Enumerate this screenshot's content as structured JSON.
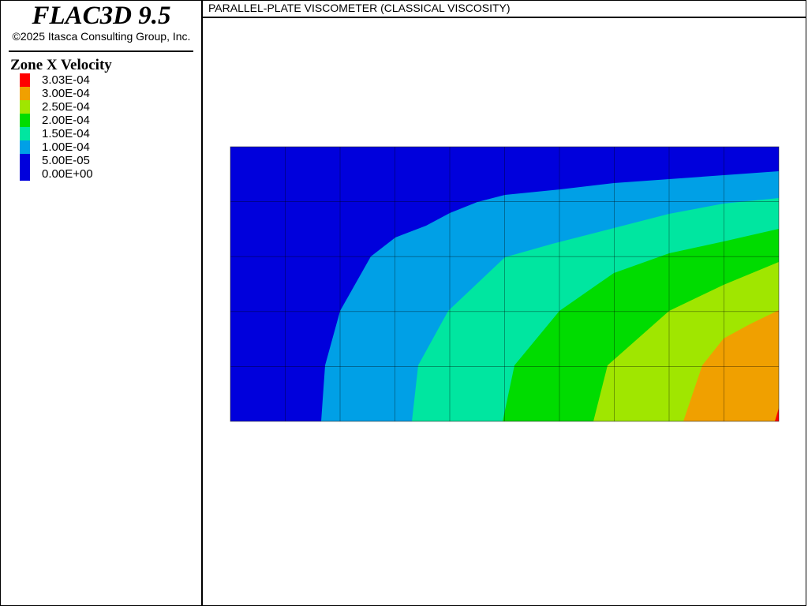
{
  "app": {
    "title": "FLAC3D 9.5",
    "copyright": "©2025 Itasca Consulting Group, Inc."
  },
  "legend": {
    "title": "Zone X Velocity",
    "items": [
      {
        "label": "3.03E-04",
        "color": "#ff0000"
      },
      {
        "label": "3.00E-04",
        "color": "#f0a000"
      },
      {
        "label": "2.50E-04",
        "color": "#a0e600"
      },
      {
        "label": "2.00E-04",
        "color": "#00dc00"
      },
      {
        "label": "1.50E-04",
        "color": "#00e6a0"
      },
      {
        "label": "1.00E-04",
        "color": "#00a0e6"
      },
      {
        "label": "5.00E-05",
        "color": "#0000dc"
      },
      {
        "label": "0.00E+00",
        "color": "#0000dc"
      }
    ]
  },
  "plot": {
    "title": "PARALLEL-PLATE VISCOMETER (CLASSICAL VISCOSITY)"
  }
}
